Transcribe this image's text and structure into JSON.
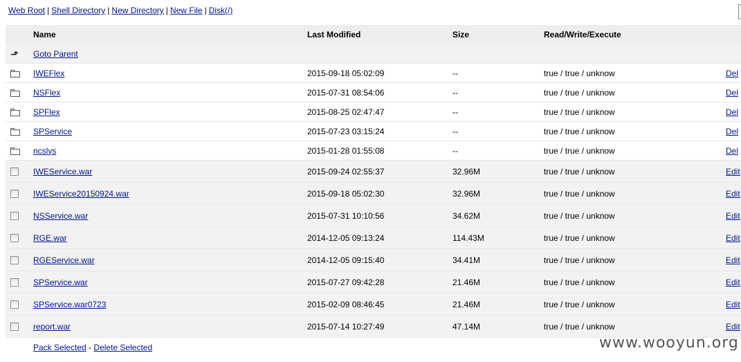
{
  "topnav": {
    "web_root": "Web Root",
    "shell_directory": "Shell Directory",
    "new_directory": "New Directory",
    "new_file": "New File",
    "disk": "Disk(/)",
    "separator": "|"
  },
  "table": {
    "columns": {
      "name": "Name",
      "last_modified": "Last Modified",
      "size": "Size",
      "permissions": "Read/Write/Execute"
    },
    "parent": {
      "icon": "up-arrow-icon",
      "label": "Goto Parent"
    },
    "directories": [
      {
        "name": "IWEFlex",
        "modified": "2015-09-18 05:02:09",
        "size": "--",
        "perm": "true / true / unknow",
        "action": "Del"
      },
      {
        "name": "NSFlex",
        "modified": "2015-07-31 08:54:06",
        "size": "--",
        "perm": "true / true / unknow",
        "action": "Del"
      },
      {
        "name": "SPFlex",
        "modified": "2015-08-25 02:47:47",
        "size": "--",
        "perm": "true / true / unknow",
        "action": "Del"
      },
      {
        "name": "SPService",
        "modified": "2015-07-23 03:15:24",
        "size": "--",
        "perm": "true / true / unknow",
        "action": "Del"
      },
      {
        "name": "ncslys",
        "modified": "2015-01-28 01:55:08",
        "size": "--",
        "perm": "true / true / unknow",
        "action": "Del"
      }
    ],
    "files": [
      {
        "name": "IWEService.war",
        "modified": "2015-09-24 02:55:37",
        "size": "32.96M",
        "perm": "true / true / unknow",
        "action": "Edit"
      },
      {
        "name": "IWEService20150924.war",
        "modified": "2015-09-18 05:02:30",
        "size": "32.96M",
        "perm": "true / true / unknow",
        "action": "Edit"
      },
      {
        "name": "NSService.war",
        "modified": "2015-07-31 10:10:56",
        "size": "34.62M",
        "perm": "true / true / unknow",
        "action": "Edit"
      },
      {
        "name": "RGE.war",
        "modified": "2014-12-05 09:13:24",
        "size": "114.43M",
        "perm": "true / true / unknow",
        "action": "Edit"
      },
      {
        "name": "RGEService.war",
        "modified": "2014-12-05 09:15:40",
        "size": "34.41M",
        "perm": "true / true / unknow",
        "action": "Edit"
      },
      {
        "name": "SPService.war",
        "modified": "2015-07-27 09:42:28",
        "size": "21.46M",
        "perm": "true / true / unknow",
        "action": "Edit"
      },
      {
        "name": "SPService.war0723",
        "modified": "2015-02-09 08:46:45",
        "size": "21.46M",
        "perm": "true / true / unknow",
        "action": "Edit"
      },
      {
        "name": "report.war",
        "modified": "2015-07-14 10:27:49",
        "size": "47.14M",
        "perm": "true / true / unknow",
        "action": "Edit"
      }
    ],
    "footer": {
      "pack_selected": "Pack Selected",
      "dash": "-",
      "delete_selected": "Delete Selected"
    }
  },
  "watermark": "www.wooyun.org",
  "colors": {
    "link": "#00148c",
    "header_bg": "#ededed",
    "row_gray": "#f2f2f2"
  }
}
